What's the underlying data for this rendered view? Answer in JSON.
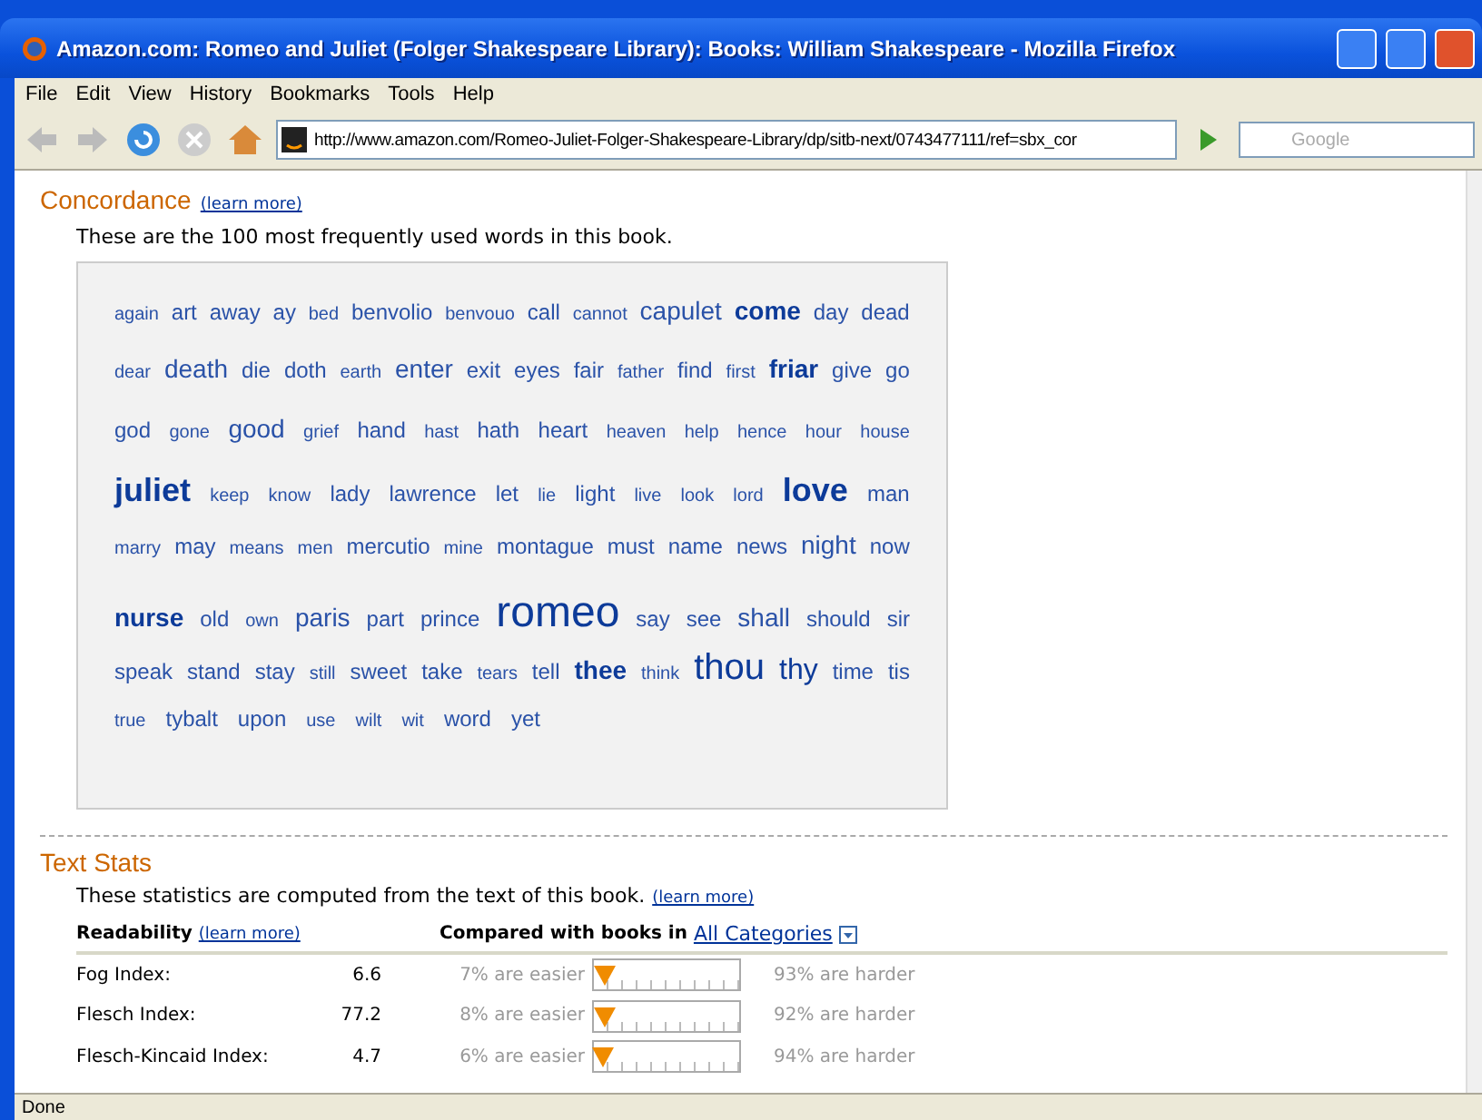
{
  "window": {
    "title": "Amazon.com: Romeo and Juliet (Folger Shakespeare Library): Books: William Shakespeare - Mozilla Firefox"
  },
  "menu": [
    "File",
    "Edit",
    "View",
    "History",
    "Bookmarks",
    "Tools",
    "Help"
  ],
  "address": {
    "value": "http://www.amazon.com/Romeo-Juliet-Folger-Shakespeare-Library/dp/sitb-next/0743477111/ref=sbx_cor"
  },
  "search": {
    "placeholder": "Google"
  },
  "concordance": {
    "title": "Concordance",
    "learn_more": "(learn more)",
    "intro": "These are the 100 most frequently used words in this book.",
    "lines": [
      [
        {
          "w": "again",
          "kind": "s"
        },
        {
          "w": "art",
          "kind": "m"
        },
        {
          "w": "away",
          "kind": "m"
        },
        {
          "w": "ay",
          "kind": "m"
        },
        {
          "w": "bed",
          "kind": "s"
        },
        {
          "w": "benvolio",
          "kind": "m"
        },
        {
          "w": "benvouo",
          "kind": "s"
        },
        {
          "w": "call",
          "kind": "m"
        },
        {
          "w": "cannot",
          "kind": "s"
        },
        {
          "w": "capulet",
          "kind": "l"
        },
        {
          "w": "come",
          "kind": "lb"
        },
        {
          "w": "day",
          "kind": "m"
        },
        {
          "w": "dead",
          "kind": "m"
        }
      ],
      [
        {
          "w": "dear",
          "kind": "s"
        },
        {
          "w": "death",
          "kind": "l"
        },
        {
          "w": "die",
          "kind": "m"
        },
        {
          "w": "doth",
          "kind": "m"
        },
        {
          "w": "earth",
          "kind": "s"
        },
        {
          "w": "enter",
          "kind": "l"
        },
        {
          "w": "exit",
          "kind": "m"
        },
        {
          "w": "eyes",
          "kind": "m"
        },
        {
          "w": "fair",
          "kind": "m"
        },
        {
          "w": "father",
          "kind": "s"
        },
        {
          "w": "find",
          "kind": "m"
        },
        {
          "w": "first",
          "kind": "s"
        },
        {
          "w": "friar",
          "kind": "lb"
        },
        {
          "w": "give",
          "kind": "m"
        },
        {
          "w": "go",
          "kind": "m"
        }
      ],
      [
        {
          "w": "god",
          "kind": "m"
        },
        {
          "w": "gone",
          "kind": "s"
        },
        {
          "w": "good",
          "kind": "l"
        },
        {
          "w": "grief",
          "kind": "s"
        },
        {
          "w": "hand",
          "kind": "m"
        },
        {
          "w": "hast",
          "kind": "s"
        },
        {
          "w": "hath",
          "kind": "m"
        },
        {
          "w": "heart",
          "kind": "m"
        },
        {
          "w": "heaven",
          "kind": "s"
        },
        {
          "w": "help",
          "kind": "s"
        },
        {
          "w": "hence",
          "kind": "s"
        },
        {
          "w": "hour",
          "kind": "s"
        },
        {
          "w": "house",
          "kind": "s"
        }
      ],
      [
        {
          "w": "juliet",
          "kind": "xlb"
        },
        {
          "w": "keep",
          "kind": "s"
        },
        {
          "w": "know",
          "kind": "s"
        },
        {
          "w": "lady",
          "kind": "m"
        },
        {
          "w": "lawrence",
          "kind": "m"
        },
        {
          "w": "let",
          "kind": "m"
        },
        {
          "w": "lie",
          "kind": "s"
        },
        {
          "w": "light",
          "kind": "m"
        },
        {
          "w": "live",
          "kind": "s"
        },
        {
          "w": "look",
          "kind": "s"
        },
        {
          "w": "lord",
          "kind": "s"
        },
        {
          "w": "love",
          "kind": "xlb"
        },
        {
          "w": "man",
          "kind": "m"
        }
      ],
      [
        {
          "w": "marry",
          "kind": "s"
        },
        {
          "w": "may",
          "kind": "m"
        },
        {
          "w": "means",
          "kind": "s"
        },
        {
          "w": "men",
          "kind": "s"
        },
        {
          "w": "mercutio",
          "kind": "m"
        },
        {
          "w": "mine",
          "kind": "s"
        },
        {
          "w": "montague",
          "kind": "m"
        },
        {
          "w": "must",
          "kind": "m"
        },
        {
          "w": "name",
          "kind": "m"
        },
        {
          "w": "news",
          "kind": "m"
        },
        {
          "w": "night",
          "kind": "l"
        },
        {
          "w": "now",
          "kind": "m"
        }
      ],
      [
        {
          "w": "nurse",
          "kind": "lb"
        },
        {
          "w": "old",
          "kind": "m"
        },
        {
          "w": "own",
          "kind": "s"
        },
        {
          "w": "paris",
          "kind": "l"
        },
        {
          "w": "part",
          "kind": "m"
        },
        {
          "w": "prince",
          "kind": "m"
        },
        {
          "w": "romeo",
          "kind": "xxl"
        },
        {
          "w": "say",
          "kind": "m"
        },
        {
          "w": "see",
          "kind": "m"
        },
        {
          "w": "shall",
          "kind": "l"
        },
        {
          "w": "should",
          "kind": "m"
        },
        {
          "w": "sir",
          "kind": "m"
        }
      ],
      [
        {
          "w": "speak",
          "kind": "m"
        },
        {
          "w": "stand",
          "kind": "m"
        },
        {
          "w": "stay",
          "kind": "m"
        },
        {
          "w": "still",
          "kind": "s"
        },
        {
          "w": "sweet",
          "kind": "m"
        },
        {
          "w": "take",
          "kind": "m"
        },
        {
          "w": "tears",
          "kind": "s"
        },
        {
          "w": "tell",
          "kind": "m"
        },
        {
          "w": "thee",
          "kind": "lb"
        },
        {
          "w": "think",
          "kind": "s"
        },
        {
          "w": "thou",
          "kind": "xl"
        },
        {
          "w": "thy",
          "kind": "xlm"
        },
        {
          "w": "time",
          "kind": "m"
        },
        {
          "w": "tis",
          "kind": "m"
        }
      ],
      [
        {
          "w": "true",
          "kind": "s"
        },
        {
          "w": "tybalt",
          "kind": "m"
        },
        {
          "w": "upon",
          "kind": "m"
        },
        {
          "w": "use",
          "kind": "s"
        },
        {
          "w": "wilt",
          "kind": "s"
        },
        {
          "w": "wit",
          "kind": "s"
        },
        {
          "w": "word",
          "kind": "m"
        },
        {
          "w": "yet",
          "kind": "m"
        }
      ]
    ]
  },
  "text_stats": {
    "title": "Text Stats",
    "intro": "These statistics are computed from the text of this book.",
    "learn_more": "(learn more)",
    "readability_label": "Readability",
    "readability_learn_more": "(learn more)",
    "compared_label": "Compared with books in",
    "category": "All Categories",
    "rows": [
      {
        "name": "Fog Index:",
        "value": "6.6",
        "easier": "7% are easier",
        "level": 0.07,
        "harder": "93% are harder"
      },
      {
        "name": "Flesch Index:",
        "value": "77.2",
        "easier": "8% are easier",
        "level": 0.08,
        "harder": "92% are harder"
      },
      {
        "name": "Flesch-Kincaid Index:",
        "value": "4.7",
        "easier": "6% are easier",
        "level": 0.06,
        "harder": "94% are harder"
      }
    ]
  },
  "status_bar": "Done"
}
